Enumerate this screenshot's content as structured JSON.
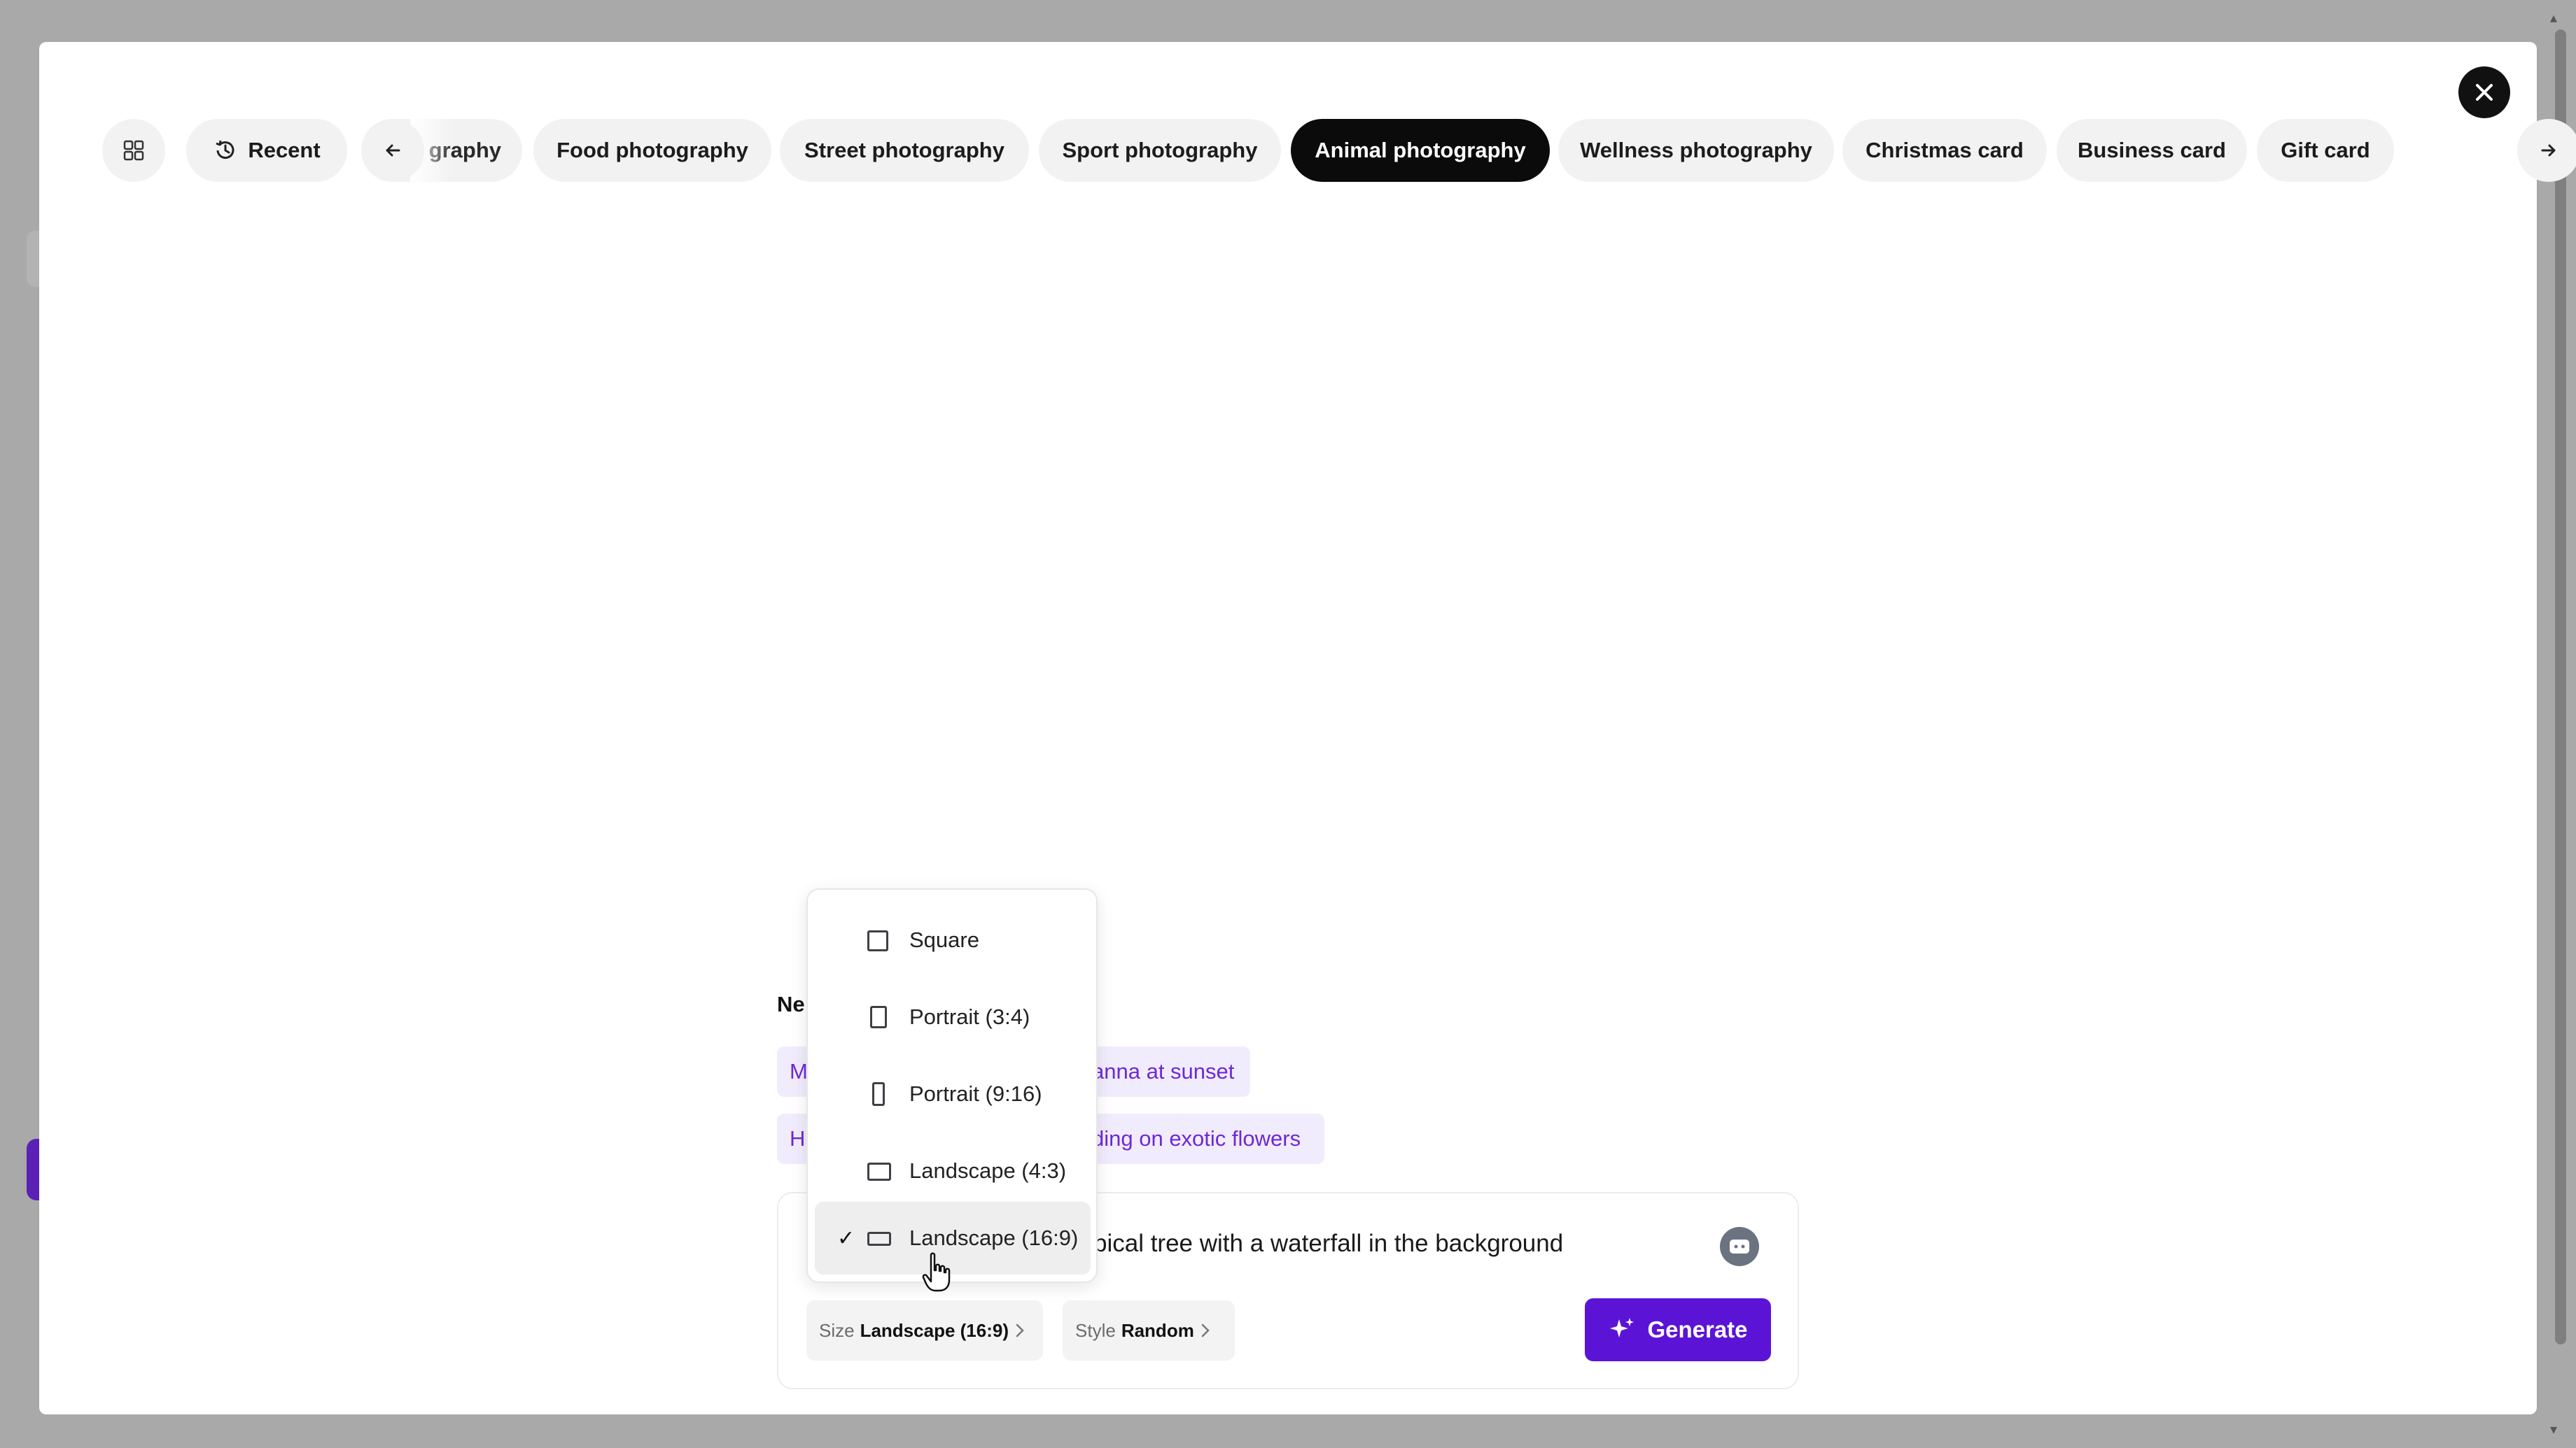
{
  "colors": {
    "accent": "#5b14d6",
    "active_chip_bg": "#0b0b0b",
    "chip_bg": "#f2f2f3",
    "suggestion_bg": "#f1ecfd",
    "suggestion_text": "#6d28d9"
  },
  "header": {
    "grid_icon": "grid-icon",
    "recent_label": "Recent",
    "prev_icon": "arrow-left-icon",
    "next_icon": "arrow-right-icon",
    "close_icon": "close-icon",
    "categories": [
      {
        "label": "graphy",
        "active": false
      },
      {
        "label": "Food photography",
        "active": false
      },
      {
        "label": "Street photography",
        "active": false
      },
      {
        "label": "Sport photography",
        "active": false
      },
      {
        "label": "Animal photography",
        "active": true
      },
      {
        "label": "Wellness photography",
        "active": false
      },
      {
        "label": "Christmas card",
        "active": false
      },
      {
        "label": "Business card",
        "active": false
      },
      {
        "label": "Gift card",
        "active": false
      }
    ]
  },
  "suggestions": {
    "section_label": "Ne",
    "items": [
      {
        "prefix": "M",
        "suffix": "anna at sunset"
      },
      {
        "prefix": "H",
        "suffix": "ding on exotic flowers"
      }
    ]
  },
  "prompt": {
    "text": "pical tree with a waterfall in the background",
    "icon": "dice-icon"
  },
  "options": {
    "size_key": "Size",
    "size_value": "Landscape (16:9)",
    "style_key": "Style",
    "style_value": "Random"
  },
  "generate": {
    "label": "Generate",
    "icon": "sparkle-icon"
  },
  "size_dropdown": {
    "items": [
      {
        "label": "Square",
        "icon": "square-icon",
        "selected": false
      },
      {
        "label": "Portrait (3:4)",
        "icon": "portrait-3-4-icon",
        "selected": false
      },
      {
        "label": "Portrait (9:16)",
        "icon": "portrait-9-16-icon",
        "selected": false
      },
      {
        "label": "Landscape (4:3)",
        "icon": "landscape-4-3-icon",
        "selected": false
      },
      {
        "label": "Landscape (16:9)",
        "icon": "landscape-16-9-icon",
        "selected": true
      }
    ]
  }
}
